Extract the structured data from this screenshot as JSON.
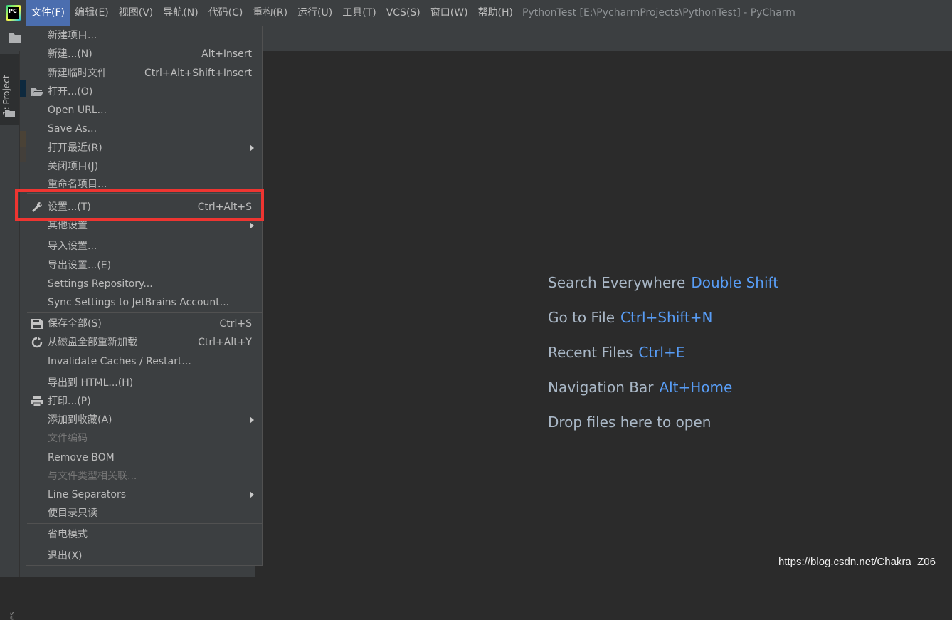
{
  "app": {
    "logo_text": "PC",
    "window_title": "PythonTest [E:\\PycharmProjects\\PythonTest] - PyCharm"
  },
  "menubar": {
    "items": [
      {
        "label": "文件(F)",
        "active": true
      },
      {
        "label": "编辑(E)"
      },
      {
        "label": "视图(V)"
      },
      {
        "label": "导航(N)"
      },
      {
        "label": "代码(C)"
      },
      {
        "label": "重构(R)"
      },
      {
        "label": "运行(U)"
      },
      {
        "label": "工具(T)"
      },
      {
        "label": "VCS(S)"
      },
      {
        "label": "窗口(W)"
      },
      {
        "label": "帮助(H)"
      }
    ]
  },
  "left_stripe": {
    "project_tab": "1: Project",
    "bottom_tab": "es"
  },
  "file_menu": {
    "items": [
      {
        "label": "新建项目..."
      },
      {
        "label": "新建...(N)",
        "shortcut": "Alt+Insert"
      },
      {
        "label": "新建临时文件",
        "shortcut": "Ctrl+Alt+Shift+Insert"
      },
      {
        "label": "打开...(O)",
        "icon": "folder-open-icon"
      },
      {
        "label": "Open URL..."
      },
      {
        "label": "Save As..."
      },
      {
        "label": "打开最近(R)",
        "submenu": true
      },
      {
        "label": "关闭项目(J)"
      },
      {
        "label": "重命名项目..."
      },
      {
        "label": "设置...(T)",
        "shortcut": "Ctrl+Alt+S",
        "icon": "wrench-icon",
        "highlighted": true
      },
      {
        "label": "其他设置",
        "submenu": true
      },
      {
        "label": "导入设置..."
      },
      {
        "label": "导出设置...(E)"
      },
      {
        "label": "Settings Repository..."
      },
      {
        "label": "Sync Settings to JetBrains Account..."
      },
      {
        "label": "保存全部(S)",
        "shortcut": "Ctrl+S",
        "icon": "save-icon"
      },
      {
        "label": "从磁盘全部重新加载",
        "shortcut": "Ctrl+Alt+Y",
        "icon": "refresh-icon"
      },
      {
        "label": "Invalidate Caches / Restart..."
      },
      {
        "label": "导出到 HTML...(H)"
      },
      {
        "label": "打印...(P)",
        "icon": "print-icon"
      },
      {
        "label": "添加到收藏(A)",
        "submenu": true
      },
      {
        "label": "文件编码",
        "disabled": true
      },
      {
        "label": "Remove BOM"
      },
      {
        "label": "与文件类型相关联...",
        "disabled": true
      },
      {
        "label": "Line Separators",
        "submenu": true
      },
      {
        "label": "使目录只读"
      },
      {
        "label": "省电模式"
      },
      {
        "label": "退出(X)"
      }
    ]
  },
  "editor_hints": [
    {
      "text": "Search Everywhere",
      "key": "Double Shift"
    },
    {
      "text": "Go to File",
      "key": "Ctrl+Shift+N"
    },
    {
      "text": "Recent Files",
      "key": "Ctrl+E"
    },
    {
      "text": "Navigation Bar",
      "key": "Alt+Home"
    },
    {
      "text": "Drop files here to open",
      "key": ""
    }
  ],
  "watermark": "https://blog.csdn.net/Chakra_Z06",
  "colors": {
    "menu_active": "#4b6eaf",
    "highlight_box": "#ee3531",
    "shortcut_key": "#589df6"
  }
}
